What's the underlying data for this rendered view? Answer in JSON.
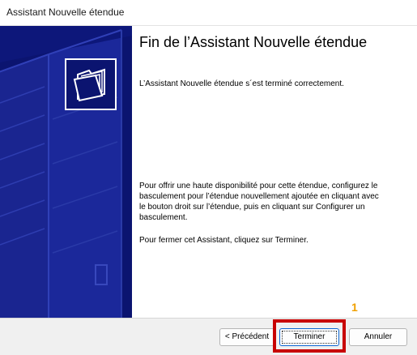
{
  "window": {
    "title": "Assistant Nouvelle étendue"
  },
  "side_panel": {
    "icon": "folder-icon"
  },
  "content": {
    "heading": "Fin de l’Assistant Nouvelle étendue",
    "completed_text": "L’Assistant Nouvelle étendue s´est terminé correctement.",
    "availability_text": "Pour offrir une haute disponibilité pour cette étendue, configurez le basculement pour l’étendue nouvellement ajoutée en cliquant avec le bouton droit sur l’étendue, puis en cliquant sur Configurer un basculement.",
    "close_text": "Pour fermer cet Assistant, cliquez sur Terminer."
  },
  "buttons": {
    "previous": "< Précédent",
    "finish": "Terminer",
    "cancel": "Annuler"
  },
  "annotation": {
    "number": "1",
    "color": "#c80000",
    "number_color": "#f0a000"
  }
}
